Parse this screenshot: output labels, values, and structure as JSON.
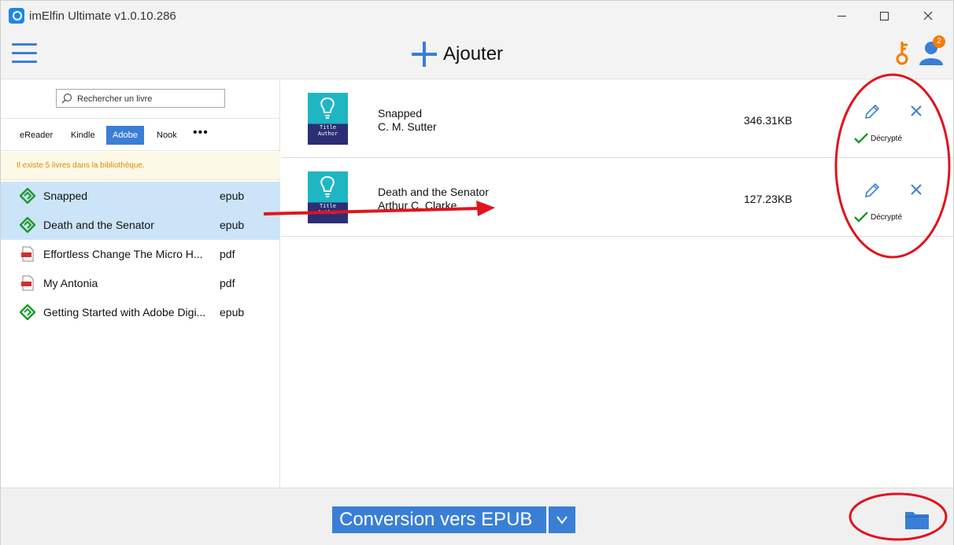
{
  "app": {
    "title": "imElfin Ultimate v1.0.10.286"
  },
  "toolbar": {
    "add_label": "Ajouter",
    "notification_count": "2"
  },
  "search": {
    "placeholder": "Rechercher un livre"
  },
  "tabs": [
    {
      "label": "eReader"
    },
    {
      "label": "Kindle"
    },
    {
      "label": "Adobe",
      "active": true
    },
    {
      "label": "Nook"
    },
    {
      "label": "•••"
    }
  ],
  "library": {
    "notice": "Il existe 5 livres dans la bibliothèque.",
    "books": [
      {
        "name": "Snapped",
        "ext": "epub",
        "selected": true,
        "icon": "epub-icon"
      },
      {
        "name": "Death and the Senator",
        "ext": "epub",
        "selected": true,
        "icon": "epub-icon"
      },
      {
        "name": "Effortless Change The Micro H...",
        "ext": "pdf",
        "selected": false,
        "icon": "pdf-icon"
      },
      {
        "name": "My Antonia",
        "ext": "pdf",
        "selected": false,
        "icon": "pdf-icon"
      },
      {
        "name": "Getting Started with Adobe Digi...",
        "ext": "epub",
        "selected": false,
        "icon": "epub-icon"
      }
    ]
  },
  "conversions": [
    {
      "title": "Snapped",
      "author": "C. M. Sutter",
      "size": "346.31KB",
      "status": "Décrypté"
    },
    {
      "title": "Death and the Senator",
      "author": "Arthur C. Clarke",
      "size": "127.23KB",
      "status": "Décrypté"
    }
  ],
  "cover": {
    "line1": "Title",
    "line2": "Author"
  },
  "bottom": {
    "convert_label": "Conversion vers EPUB"
  },
  "colors": {
    "accent": "#3a7fd5",
    "annotation": "#e0141e",
    "success": "#1a9a2a",
    "warning": "#e08a00"
  }
}
